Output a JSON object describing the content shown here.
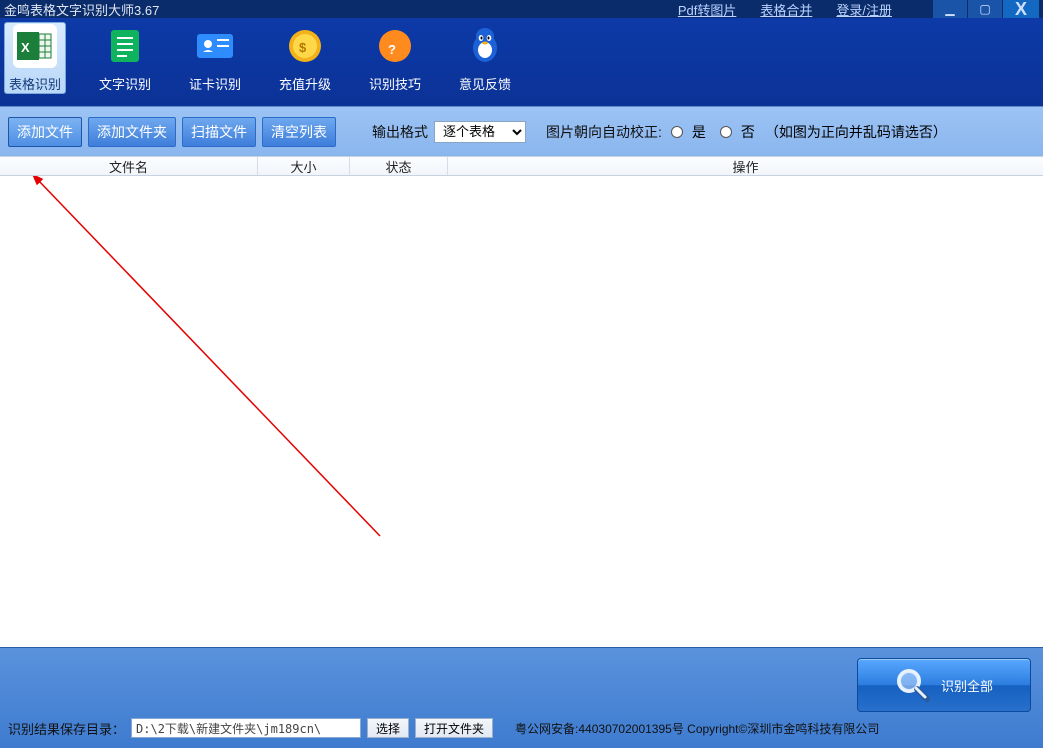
{
  "title": "金鸣表格文字识别大师3.67",
  "top_links": [
    "Pdf转图片",
    "表格合并",
    "登录/注册"
  ],
  "toolbar": [
    {
      "label": "表格识别",
      "icon": "excel"
    },
    {
      "label": "文字识别",
      "icon": "doc"
    },
    {
      "label": "证卡识别",
      "icon": "idcard"
    },
    {
      "label": "充值升级",
      "icon": "coin"
    },
    {
      "label": "识别技巧",
      "icon": "question"
    },
    {
      "label": "意见反馈",
      "icon": "qq"
    }
  ],
  "actions": {
    "add_file": "添加文件",
    "add_folder": "添加文件夹",
    "scan_file": "扫描文件",
    "clear_list": "清空列表",
    "output_label": "输出格式",
    "output_value": "逐个表格",
    "auto_label": "图片朝向自动校正:",
    "yes": "是",
    "no": "否",
    "note": "（如图为正向并乱码请选否）"
  },
  "columns": {
    "name": "文件名",
    "size": "大小",
    "status": "状态",
    "action": "操作"
  },
  "big_button": "识别全部",
  "footer": {
    "save_label": "识别结果保存目录：",
    "path": "D:\\2下载\\新建文件夹\\jm189cn\\",
    "choose": "选择",
    "open": "打开文件夹",
    "copyright": "粤公网安备:44030702001395号 Copyright©深圳市金鸣科技有限公司"
  }
}
